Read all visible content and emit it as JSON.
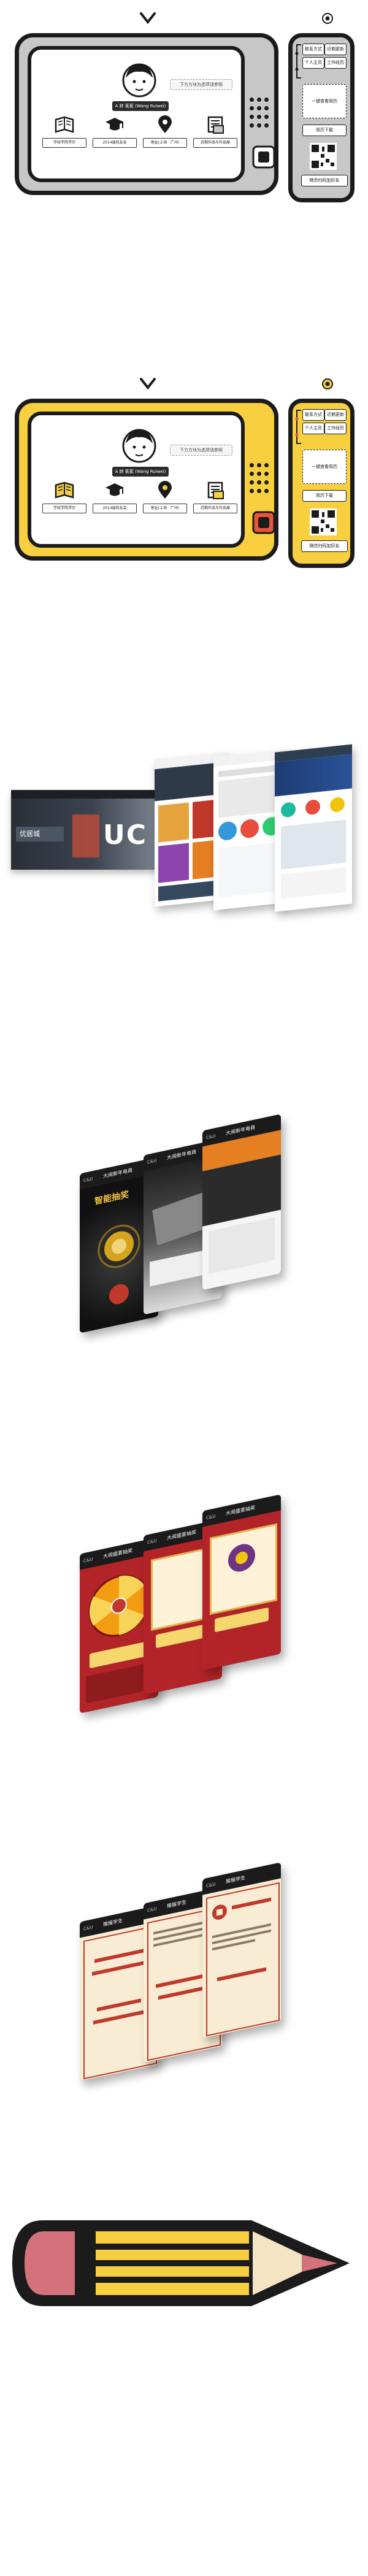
{
  "tv_gray": {
    "subtitle": "下方方块为选项请参照",
    "name_tag": "A 胖 蕉蕉 (Wang Ruiwei)",
    "categories": [
      {
        "icon": "book-icon",
        "label": "学校学院学历"
      },
      {
        "icon": "graduation-cap-icon",
        "label": "2014届校友会"
      },
      {
        "icon": "location-pin-icon",
        "label": "地址(上海 · 广州)"
      },
      {
        "icon": "document-icon",
        "label": "近期作品与作品展"
      }
    ],
    "remote": {
      "btn_1": "联系方式",
      "btn_2": "近期更新",
      "btn_3": "个人主页",
      "btn_4": "工作经历",
      "feature": "一键查看简历",
      "download": "简历下载",
      "footer": "微信扫码加好友"
    }
  },
  "tv_yellow": {
    "subtitle": "下方方块为选项请参照",
    "name_tag": "A 胖 蕉蕉 (Wang Ruiwei)",
    "categories": [
      {
        "icon": "book-icon",
        "label": "学校学院学历"
      },
      {
        "icon": "graduation-cap-icon",
        "label": "2014届校友会"
      },
      {
        "icon": "location-pin-icon",
        "label": "地址(上海 · 广州)"
      },
      {
        "icon": "document-icon",
        "label": "近期作品与作品展"
      }
    ],
    "remote": {
      "btn_1": "联系方式",
      "btn_2": "近期更新",
      "btn_3": "个人主页",
      "btn_4": "工作经历",
      "feature": "一键查看简历",
      "download": "简历下载",
      "footer": "微信扫码加好友"
    }
  },
  "web": {
    "strip_logo": "优居城",
    "strip_big": "UC"
  },
  "phones": {
    "set1": [
      "大闹新年电商",
      "大闹新年电商",
      "大闹新年电商"
    ],
    "set1_hero": "智能抽奖",
    "set2": [
      "大闹盛宴抽奖",
      "大闹盛宴抽奖",
      "大闹盛宴抽奖"
    ],
    "set3": [
      "猴猴学生",
      "猴猴学生",
      "猴猴学生"
    ],
    "status": "C&U"
  },
  "colors": {
    "yellow": "#f7cf3f",
    "gray": "#c7c7c7",
    "ink": "#1b1b1b",
    "red": "#c0392b",
    "orange": "#f39c12"
  }
}
